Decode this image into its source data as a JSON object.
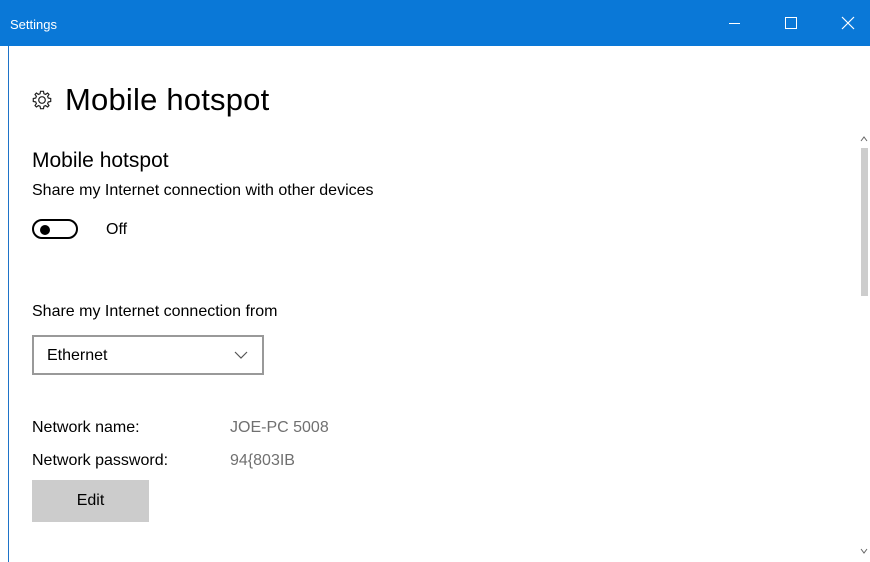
{
  "window": {
    "title": "Settings"
  },
  "page": {
    "title": "Mobile hotspot",
    "icon": "gear-icon"
  },
  "hotspot": {
    "section_title": "Mobile hotspot",
    "share_description": "Share my Internet connection with other devices",
    "toggle_state": "Off",
    "toggle_on": false
  },
  "share_from": {
    "label": "Share my Internet connection from",
    "selected": "Ethernet"
  },
  "network": {
    "name_label": "Network name:",
    "name_value": "JOE-PC 5008",
    "password_label": "Network password:",
    "password_value": "94{803IB",
    "edit_label": "Edit"
  },
  "colors": {
    "titlebar": "#0a78d7",
    "button": "#cccccc",
    "muted_text": "#707070"
  }
}
